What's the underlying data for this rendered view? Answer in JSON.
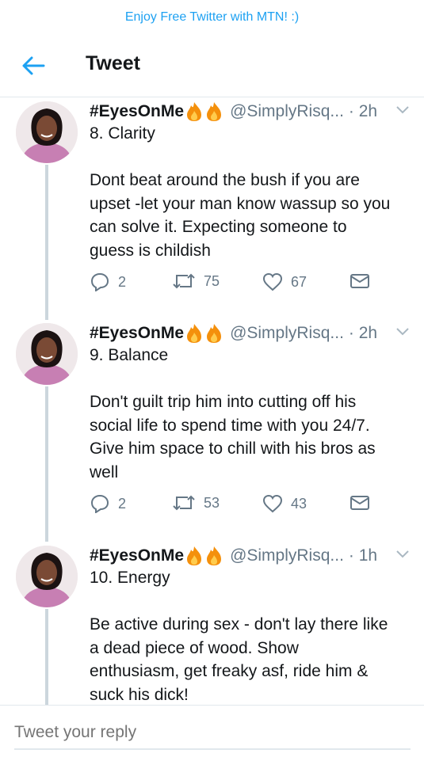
{
  "banner": {
    "text": "Enjoy Free Twitter with MTN! :)"
  },
  "header": {
    "back_icon": "arrow-left-icon",
    "title": "Tweet"
  },
  "tweets": [
    {
      "display_name": "#EyesOnMe",
      "emoji": "fire-emoji-x2",
      "handle": "@SimplyRisq...",
      "time": "· 2h",
      "lines": [
        "8. Clarity",
        "",
        "Dont beat around the bush if you are",
        "upset -let your man know wassup so you",
        "can solve it. Expecting someone to",
        "guess is childish"
      ],
      "replies": "2",
      "retweets": "75",
      "likes": "67"
    },
    {
      "display_name": "#EyesOnMe",
      "emoji": "fire-emoji-x2",
      "handle": "@SimplyRisq...",
      "time": "· 2h",
      "lines": [
        "9. Balance",
        "",
        "Don't guilt trip him into cutting off his",
        "social life to spend time with you 24/7.",
        "Give him space to chill with his bros as",
        "well"
      ],
      "replies": "2",
      "retweets": "53",
      "likes": "43"
    },
    {
      "display_name": "#EyesOnMe",
      "emoji": "fire-emoji-x2",
      "handle": "@SimplyRisq...",
      "time": "· 1h",
      "lines": [
        "10. Energy",
        "",
        "Be active during sex - don't lay there like",
        "a dead piece of wood. Show",
        "enthusiasm, get freaky asf, ride him &",
        "suck his dick!"
      ]
    }
  ],
  "reply": {
    "placeholder": "Tweet your reply"
  },
  "colors": {
    "accent": "#1da1f2",
    "text": "#14171a",
    "muted": "#657786",
    "line": "#ccd6dd",
    "flame": "#f4900c"
  }
}
